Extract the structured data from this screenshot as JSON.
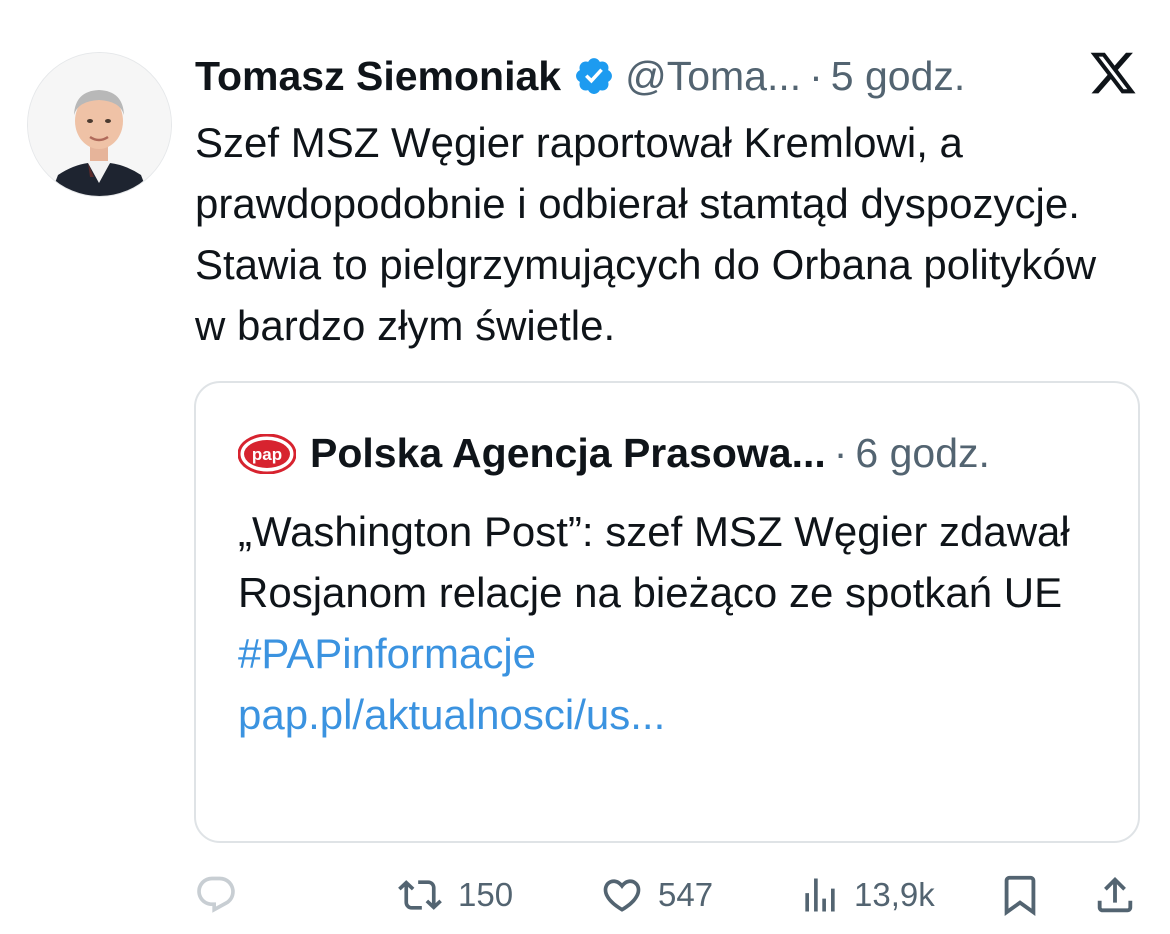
{
  "tweet": {
    "author_name": "Tomasz Siemoniak",
    "handle": "@Toma...",
    "dot": "·",
    "time": "5 godz.",
    "text": "Szef MSZ Węgier raportował Kremlowi, a prawdopodobnie i odbierał stamtąd dyspozycje. Stawia to pielgrzymujących do Orbana polityków w bardzo złym świetle."
  },
  "quote": {
    "author_name": "Polska Agencja Prasowa...",
    "dot": "·",
    "time": "6 godz.",
    "text": "„Washington Post”: szef MSZ Węgier zdawał Rosjanom relacje na bieżąco ze spotkań UE",
    "hashtag": "#PAPinformacje",
    "link": "pap.pl/aktualnosci/us...",
    "logo_text": "pap"
  },
  "actions": {
    "reply_count": "",
    "retweet_count": "150",
    "like_count": "547",
    "views_count": "13,9k"
  },
  "colors": {
    "verified_blue": "#1d9bf0",
    "link_blue": "#3b93e0",
    "secondary_text": "#536471",
    "pap_red": "#d7232f"
  },
  "icons": [
    "verified-badge-icon",
    "x-logo-icon",
    "reply-icon",
    "retweet-icon",
    "like-icon",
    "views-icon",
    "bookmark-icon",
    "share-icon"
  ]
}
